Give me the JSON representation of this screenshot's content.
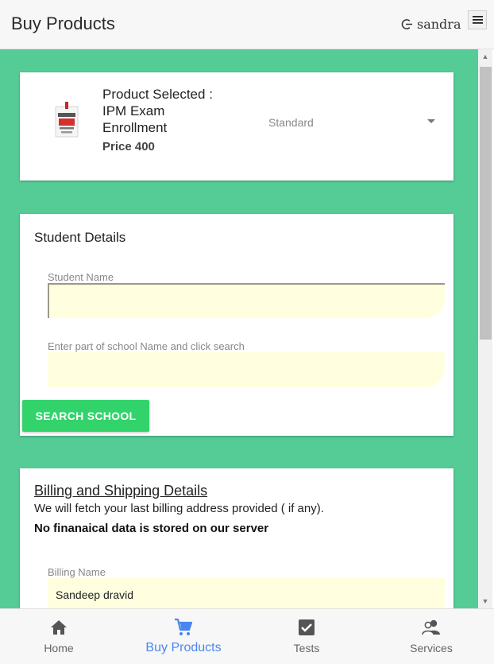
{
  "header": {
    "title": "Buy Products",
    "user": "sandra",
    "logout_icon": "logout-icon",
    "menu_icon": "hamburger-menu-icon"
  },
  "product": {
    "selected_text": "Product Selected : IPM Exam Enrollment",
    "price_text": "Price 400",
    "variant": "Standard"
  },
  "student": {
    "heading": "Student Details",
    "name_label": "Student Name",
    "name_value": "",
    "school_label": "Enter part of school Name and click search",
    "school_value": "",
    "search_button": "SEARCH SCHOOL"
  },
  "billing": {
    "heading": "Billing and Shipping Details",
    "note": "We will fetch your last billing address provided ( if any).",
    "bold_note": "No finanaical data is stored on our server",
    "name_label": "Billing Name",
    "name_value": "Sandeep dravid"
  },
  "nav": {
    "items": [
      {
        "label": "Home",
        "icon": "home-icon"
      },
      {
        "label": "Buy Products",
        "icon": "cart-icon"
      },
      {
        "label": "Tests",
        "icon": "checkbox-icon"
      },
      {
        "label": "Services",
        "icon": "people-icon"
      }
    ],
    "active_index": 1
  },
  "colors": {
    "accent_green": "#55cc96",
    "button_green": "#33d36c",
    "active_blue": "#4a86f0",
    "field_bg": "#ffffe0"
  }
}
